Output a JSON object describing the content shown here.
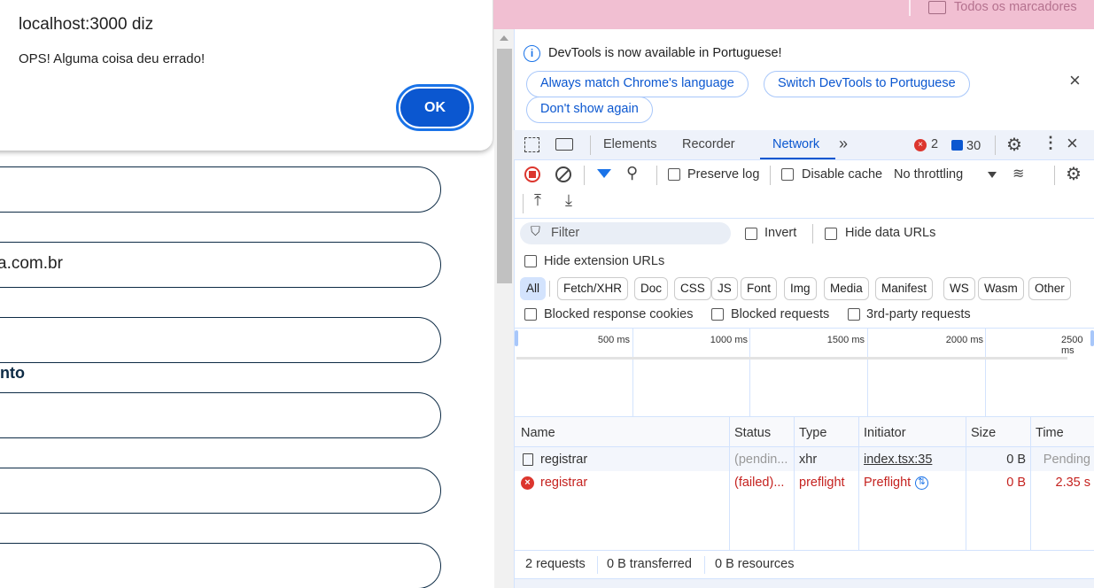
{
  "dialog": {
    "title": "localhost:3000 diz",
    "message": "OPS! Alguma coisa deu errado!",
    "ok_label": "OK"
  },
  "page": {
    "inputs": [
      "",
      "a.com.br",
      "",
      "",
      "",
      ""
    ],
    "label_partial": "nto"
  },
  "bookmarks": {
    "all_label": "Todos os marcadores"
  },
  "infobar": {
    "message": "DevTools is now available in Portuguese!",
    "buttons": [
      "Always match Chrome's language",
      "Switch DevTools to Portuguese",
      "Don't show again"
    ]
  },
  "tabs": {
    "items": [
      "Elements",
      "Recorder",
      "Network"
    ],
    "active": "Network",
    "errors": "2",
    "messages": "30"
  },
  "toolbar": {
    "preserve_log": "Preserve log",
    "disable_cache": "Disable cache",
    "throttling": "No throttling"
  },
  "filter": {
    "placeholder": "Filter",
    "invert": "Invert",
    "hide_data_urls": "Hide data URLs",
    "hide_extension_urls": "Hide extension URLs",
    "types": [
      "All",
      "Fetch/XHR",
      "Doc",
      "CSS",
      "JS",
      "Font",
      "Img",
      "Media",
      "Manifest",
      "WS",
      "Wasm",
      "Other"
    ],
    "active_type": "All",
    "blocked_cookies": "Blocked response cookies",
    "blocked_requests": "Blocked requests",
    "third_party": "3rd-party requests"
  },
  "timeline": {
    "ticks": [
      "500 ms",
      "1000 ms",
      "1500 ms",
      "2000 ms",
      "2500 ms"
    ]
  },
  "table": {
    "headers": [
      "Name",
      "Status",
      "Type",
      "Initiator",
      "Size",
      "Time"
    ],
    "rows": [
      {
        "name": "registrar",
        "status": "(pendin...",
        "type": "xhr",
        "initiator": "index.tsx:35",
        "size": "0 B",
        "time": "Pending",
        "error": false
      },
      {
        "name": "registrar",
        "status": "(failed)...",
        "type": "preflight",
        "initiator": "Preflight",
        "size": "0 B",
        "time": "2.35 s",
        "error": true
      }
    ]
  },
  "footer": {
    "requests": "2 requests",
    "transferred": "0 B transferred",
    "resources": "0 B resources"
  },
  "colors": {
    "accent": "#0b57d0",
    "error": "#c5221f",
    "ok_button": "#0b57d0",
    "pink_bar": "#f1bfd2"
  }
}
